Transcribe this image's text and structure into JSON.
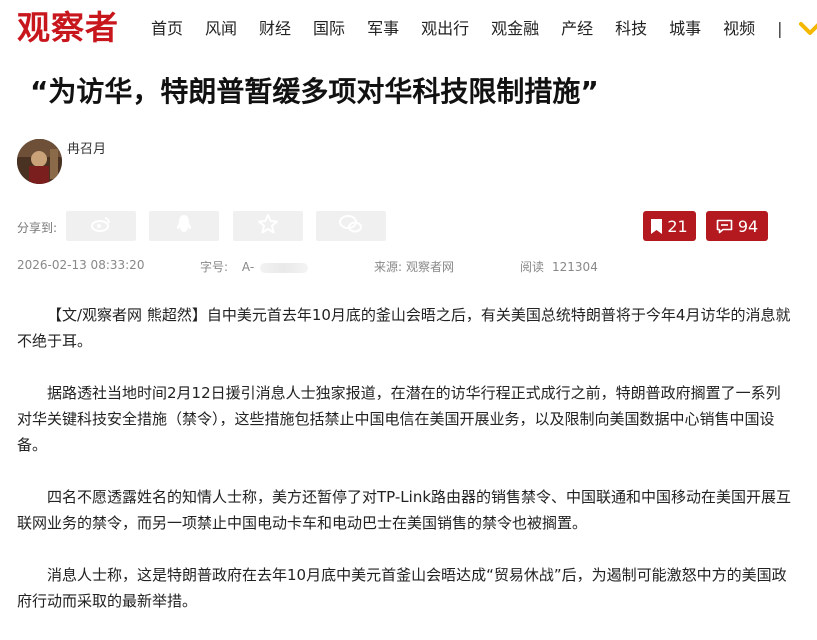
{
  "site": {
    "logo": "观察者"
  },
  "nav": {
    "items": [
      "首页",
      "风闻",
      "财经",
      "国际",
      "军事",
      "观出行",
      "观金融",
      "产经",
      "科技",
      "城事",
      "视频"
    ],
    "separator": "|",
    "more_icon": "chevron-down-icon",
    "more_color": "#f5b800"
  },
  "article": {
    "title": "“为访华，特朗普暂缓多项对华科技限制措施”",
    "author": "冉召月",
    "share_label": "分享到:",
    "share_icons": [
      "weibo-icon",
      "qq-icon",
      "star-icon",
      "wechat-icon"
    ],
    "bookmark_count": "21",
    "comment_count": "94",
    "datetime": "2026-02-13 08:33:20",
    "font_size_label": "字号:",
    "font_size_value": "A-",
    "source_label": "来源:",
    "source_value": "观察者网",
    "read_label": "阅读",
    "read_count": "121304",
    "paragraphs": [
      "【文/观察者网 熊超然】自中美元首去年10月底的釜山会晤之后，有关美国总统特朗普将于今年4月访华的消息就不绝于耳。",
      "据路透社当地时间2月12日援引消息人士独家报道，在潜在的访华行程正式成行之前，特朗普政府搁置了一系列对华关键科技安全措施（禁令），这些措施包括禁止中国电信在美国开展业务，以及限制向美国数据中心销售中国设备。",
      "四名不愿透露姓名的知情人士称，美方还暂停了对TP-Link路由器的销售禁令、中国联通和中国移动在美国开展互联网业务的禁令，而另一项禁止中国电动卡车和电动巴士在美国销售的禁令也被搁置。",
      "消息人士称，这是特朗普政府在去年10月底中美元首釜山会晤达成“贸易休战”后，为遏制可能激怒中方的美国政府行动而采取的最新举措。"
    ]
  },
  "colors": {
    "brand_red": "#c8161d",
    "button_red": "#b3191f",
    "share_bg": "#f0f0f0"
  }
}
